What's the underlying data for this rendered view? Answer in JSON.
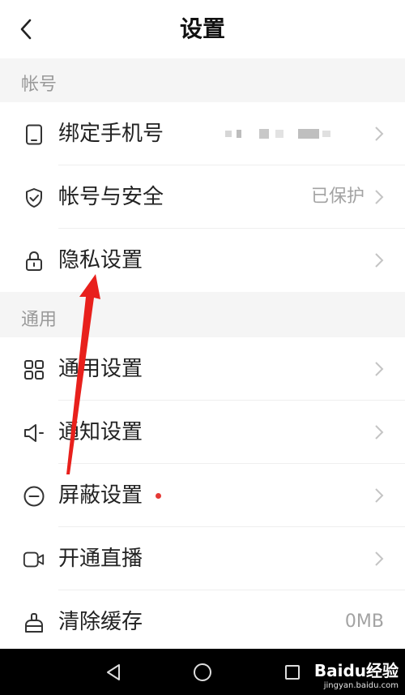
{
  "header": {
    "title": "设置",
    "back_icon": "chevron-left-icon"
  },
  "sections": [
    {
      "title": "帐号",
      "items": [
        {
          "label": "绑定手机号",
          "icon": "phone-icon",
          "value": "",
          "value_blurred": true
        },
        {
          "label": "帐号与安全",
          "icon": "shield-check-icon",
          "value": "已保护"
        },
        {
          "label": "隐私设置",
          "icon": "lock-icon",
          "value": ""
        }
      ]
    },
    {
      "title": "通用",
      "items": [
        {
          "label": "通用设置",
          "icon": "grid-icon",
          "value": ""
        },
        {
          "label": "通知设置",
          "icon": "speaker-icon",
          "value": ""
        },
        {
          "label": "屏蔽设置",
          "icon": "block-icon",
          "value": "",
          "badge_dot": true
        },
        {
          "label": "开通直播",
          "icon": "video-camera-icon",
          "value": ""
        },
        {
          "label": "清除缓存",
          "icon": "broom-icon",
          "value": "0MB"
        }
      ]
    }
  ],
  "system_nav": {
    "buttons": [
      "back-triangle-icon",
      "home-circle-icon",
      "recents-square-icon"
    ]
  },
  "watermark": {
    "text": "Baidu经验",
    "sub": "jingyan.baidu.com"
  },
  "colors": {
    "accent_dot": "#e53935",
    "annotation_arrow": "#e8201c",
    "background": "#f5f5f5"
  }
}
